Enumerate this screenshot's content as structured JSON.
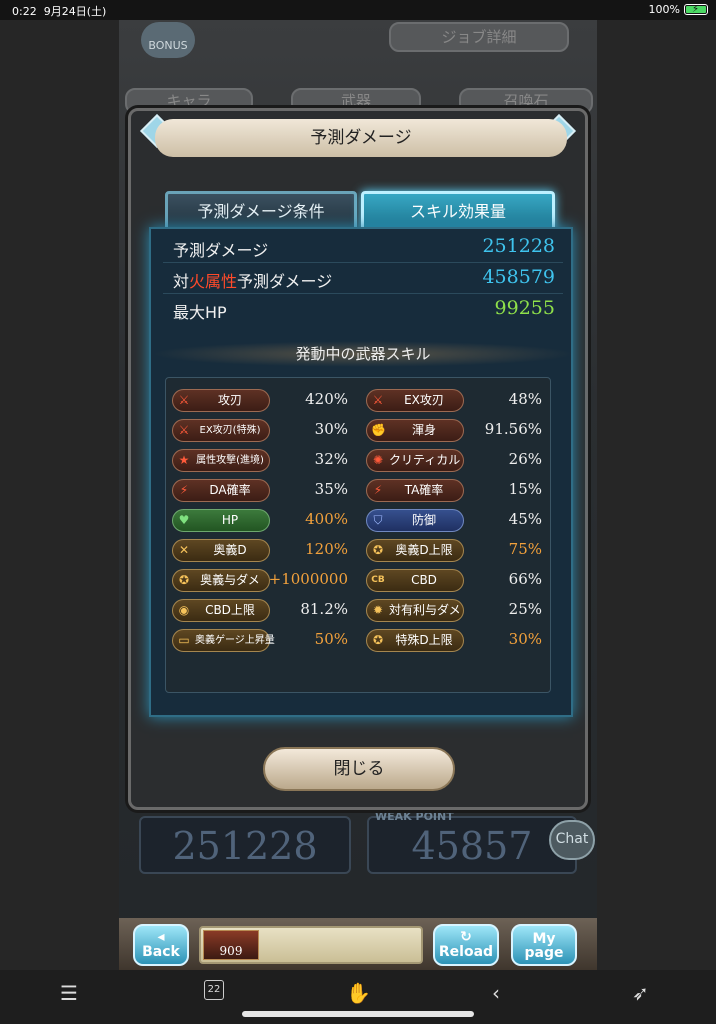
{
  "status_bar": {
    "time": "0:22",
    "date": "9月24日(土)",
    "battery": "100%"
  },
  "background": {
    "bonus": "BONUS",
    "job_detail": "ジョブ詳細",
    "tabs": [
      "キャラ",
      "武器",
      "召喚石"
    ],
    "big_damage": "251228",
    "big_weak": "45857",
    "weak_point": "WEAK POINT"
  },
  "modal": {
    "title": "予測ダメージ",
    "tabs": [
      {
        "label": "予測ダメージ条件",
        "active": false
      },
      {
        "label": "スキル効果量",
        "active": true
      }
    ],
    "stats": [
      {
        "label": "予測ダメージ",
        "value": "251228",
        "color": "#3fc4ee"
      },
      {
        "label_pre": "対",
        "label_hl": "火属性",
        "label_post": "予測ダメージ",
        "value": "458579",
        "color": "#3fc4ee"
      },
      {
        "label": "最大HP",
        "value": "99255",
        "color": "#8fe14a"
      }
    ],
    "skills_heading": "発動中の武器スキル",
    "skills": [
      {
        "icon": "sword-icon",
        "glyph": "⚔",
        "name": "攻刃",
        "value": "420%",
        "style": "red",
        "accent": false
      },
      {
        "icon": "sword-icon",
        "glyph": "⚔",
        "name": "EX攻刃",
        "value": "48%",
        "style": "red",
        "accent": false
      },
      {
        "icon": "sword-icon",
        "glyph": "⚔",
        "name": "EX攻刃(特殊)",
        "value": "30%",
        "style": "red",
        "accent": false
      },
      {
        "icon": "muscle-icon",
        "glyph": "✊",
        "name": "渾身",
        "value": "91.56%",
        "style": "red",
        "accent": false
      },
      {
        "icon": "star-icon",
        "glyph": "★",
        "name": "属性攻撃(進境)",
        "value": "32%",
        "style": "red",
        "accent": false
      },
      {
        "icon": "burst-icon",
        "glyph": "✺",
        "name": "クリティカル",
        "value": "26%",
        "style": "red",
        "accent": false
      },
      {
        "icon": "double-slash-icon",
        "glyph": "⚡",
        "name": "DA確率",
        "value": "35%",
        "style": "red",
        "accent": false
      },
      {
        "icon": "triple-slash-icon",
        "glyph": "⚡",
        "name": "TA確率",
        "value": "15%",
        "style": "red",
        "accent": false
      },
      {
        "icon": "heart-icon",
        "glyph": "♥",
        "name": "HP",
        "value": "400%",
        "style": "green",
        "accent": true
      },
      {
        "icon": "shield-icon",
        "glyph": "⛉",
        "name": "防御",
        "value": "45%",
        "style": "blue",
        "accent": false
      },
      {
        "icon": "crossed-swords-icon",
        "glyph": "✕",
        "name": "奥義D",
        "value": "120%",
        "style": "gold",
        "accent": true
      },
      {
        "icon": "ougi-cap-icon",
        "glyph": "✪",
        "name": "奥義D上限",
        "value": "75%",
        "style": "gold",
        "accent": true
      },
      {
        "icon": "ougi-bonus-icon",
        "glyph": "✪",
        "name": "奥義与ダメ",
        "value": "+1000000",
        "style": "gold",
        "accent": true
      },
      {
        "icon": "cb-icon",
        "glyph": "CB",
        "name": "CBD",
        "value": "66%",
        "style": "gold",
        "accent": false
      },
      {
        "icon": "cb-cap-icon",
        "glyph": "◉",
        "name": "CBD上限",
        "value": "81.2%",
        "style": "gold",
        "accent": false
      },
      {
        "icon": "advantage-icon",
        "glyph": "✹",
        "name": "対有利与ダメ",
        "value": "25%",
        "style": "gold",
        "accent": false
      },
      {
        "icon": "gauge-icon",
        "glyph": "▭",
        "name": "奥義ゲージ上昇量",
        "value": "50%",
        "style": "gold",
        "accent": true
      },
      {
        "icon": "special-cap-icon",
        "glyph": "✪",
        "name": "特殊D上限",
        "value": "30%",
        "style": "gold",
        "accent": true
      }
    ],
    "close_label": "閉じる"
  },
  "game_bar": {
    "back": "Back",
    "reload": "Reload",
    "mypage": "My page",
    "count": "909"
  },
  "chat_label": "Chat",
  "nav": {
    "tab_count": "22"
  }
}
